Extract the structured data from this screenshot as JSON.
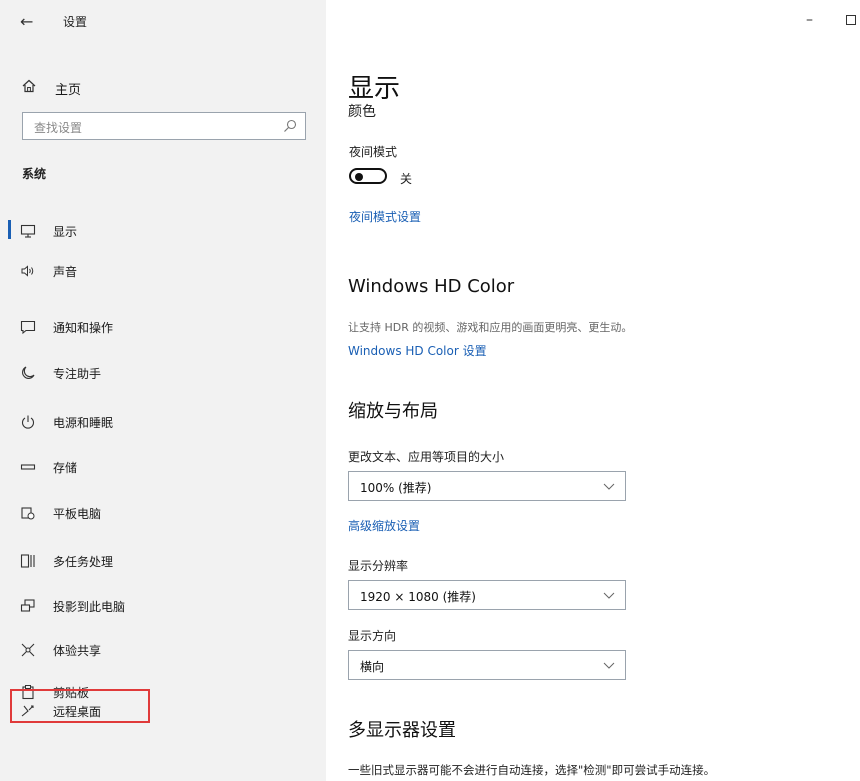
{
  "window": {
    "title": "设置",
    "back_glyph": "←",
    "minimize_glyph": "–"
  },
  "sidebar": {
    "home_label": "主页",
    "search_placeholder": "查找设置",
    "section_header": "系统",
    "items": [
      {
        "label": "显示",
        "icon": "monitor-icon",
        "active": true
      },
      {
        "label": "声音",
        "icon": "speaker-icon"
      },
      {
        "label": "通知和操作",
        "icon": "notification-icon"
      },
      {
        "label": "专注助手",
        "icon": "moon-icon"
      },
      {
        "label": "电源和睡眠",
        "icon": "power-icon"
      },
      {
        "label": "存储",
        "icon": "storage-icon"
      },
      {
        "label": "平板电脑",
        "icon": "tablet-icon"
      },
      {
        "label": "多任务处理",
        "icon": "multitask-icon"
      },
      {
        "label": "投影到此电脑",
        "icon": "project-icon"
      },
      {
        "label": "体验共享",
        "icon": "share-experience-icon"
      },
      {
        "label": "剪贴板",
        "icon": "clipboard-icon"
      },
      {
        "label": "远程桌面",
        "icon": "remote-desktop-icon",
        "highlighted": true
      }
    ]
  },
  "main": {
    "title": "显示",
    "subtitle": "颜色",
    "night_light": {
      "label": "夜间模式",
      "state": "关",
      "settings_link": "夜间模式设置"
    },
    "hdr": {
      "title": "Windows HD Color",
      "description": "让支持 HDR 的视频、游戏和应用的画面更明亮、更生动。",
      "settings_link": "Windows HD Color 设置"
    },
    "scale_layout": {
      "title": "缩放与布局",
      "scale_label": "更改文本、应用等项目的大小",
      "scale_value": "100% (推荐)",
      "advanced_link": "高级缩放设置",
      "resolution_label": "显示分辨率",
      "resolution_value": "1920 × 1080 (推荐)",
      "orientation_label": "显示方向",
      "orientation_value": "横向"
    },
    "multi_display": {
      "title": "多显示器设置",
      "description": "一些旧式显示器可能不会进行自动连接，选择\"检测\"即可尝试手动连接。"
    }
  },
  "colors": {
    "accent": "#1a5fb4",
    "highlight_border": "#e03a3a",
    "sidebar_bg": "#f2f2f2"
  }
}
